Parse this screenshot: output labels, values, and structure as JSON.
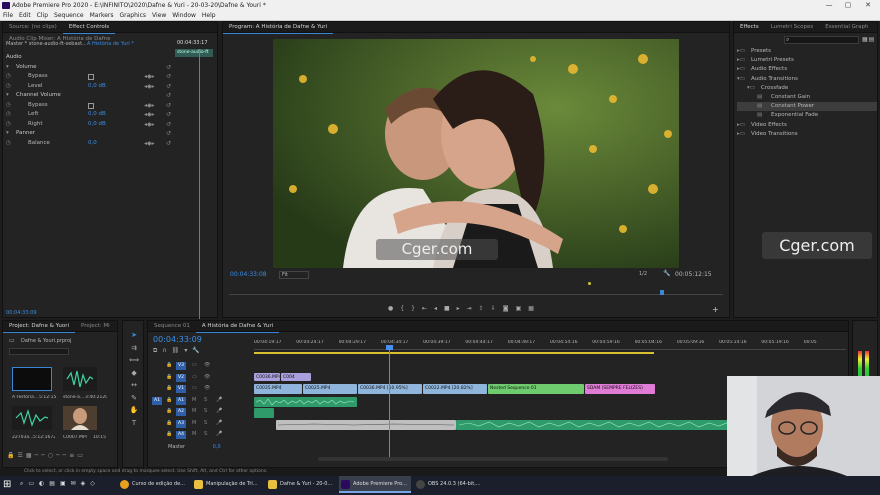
{
  "window": {
    "title": "Adobe Premiere Pro 2020 - E:\\INFINITO\\2020\\Dafne & Yuri - 20-03-20\\Dafne & Youri *",
    "controls": [
      "—",
      "▢",
      "✕"
    ]
  },
  "menu": [
    "File",
    "Edit",
    "Clip",
    "Sequence",
    "Markers",
    "Graphics",
    "View",
    "Window",
    "Help"
  ],
  "source_panel": {
    "tabs": [
      "Source: (no clips)",
      "Effect Controls",
      "Audio Clip Mixer: A História de Dafne"
    ],
    "active_tab": 1,
    "master_label": "Master * stone-audio-ft-sebast...",
    "sequence_label": "A História de Yuri *",
    "clip_tag": "stone-audio-ft",
    "header_time": "00:04:33:17",
    "section": "Audio",
    "params": [
      {
        "name": "Volume",
        "type": "group"
      },
      {
        "name": "Bypass",
        "type": "check"
      },
      {
        "name": "Level",
        "value": "0,0 dB"
      },
      {
        "name": "Channel Volume",
        "type": "group"
      },
      {
        "name": "Bypass",
        "type": "check"
      },
      {
        "name": "Left",
        "value": "0,0 dB"
      },
      {
        "name": "Right",
        "value": "0,0 dB"
      },
      {
        "name": "Panner",
        "type": "group"
      },
      {
        "name": "Balance",
        "value": "0,0"
      }
    ],
    "footer_time": "00:04:33:09"
  },
  "program_panel": {
    "tab": "Program: A História de Dafne & Yuri",
    "time": "00:04:33:08",
    "fit": "Fit",
    "zoom": "1/2",
    "duration": "00:05:12:15",
    "watermark": "Cger.com"
  },
  "effects_panel": {
    "tabs": [
      "Effects",
      "Lumetri Scopes",
      "Essential Graph"
    ],
    "tree": [
      {
        "label": "Presets",
        "level": 0,
        "open": false
      },
      {
        "label": "Lumetri Presets",
        "level": 0,
        "open": false
      },
      {
        "label": "Audio Effects",
        "level": 0,
        "open": false
      },
      {
        "label": "Audio Transitions",
        "level": 0,
        "open": true
      },
      {
        "label": "Crossfade",
        "level": 1,
        "open": true
      },
      {
        "label": "Constant Gain",
        "level": 2
      },
      {
        "label": "Constant Power",
        "level": 2,
        "selected": true
      },
      {
        "label": "Exponential Fade",
        "level": 2
      },
      {
        "label": "Video Effects",
        "level": 0,
        "open": false
      },
      {
        "label": "Video Transitions",
        "level": 0,
        "open": false
      }
    ],
    "watermark": "Cger.com"
  },
  "project_panel": {
    "tabs": [
      "Project: Dafne & Yuori",
      "Project: Mi"
    ],
    "filename": "Dafne & Youri.prproj",
    "items": [
      {
        "name": "A História...",
        "dur": "5:12:15"
      },
      {
        "name": "stone-a...",
        "dur": "3:40:21200"
      },
      {
        "name": "22703a...",
        "dur": "5:12:16720"
      },
      {
        "name": "C0007.MP4",
        "dur": "10:15"
      }
    ]
  },
  "timeline": {
    "tabs": [
      "Sequence 01",
      "A História de Dafne & Yuri"
    ],
    "active_tab": 1,
    "time": "00:04:33:09",
    "ruler": [
      "00:04:19:17",
      "00:04:24:17",
      "00:04:29:17",
      "00:04:34:17",
      "00:04:39:17",
      "00:04:44:17",
      "00:04:49:17",
      "00:04:54:16",
      "00:04:59:16",
      "00:05:04:16",
      "00:05:09:16",
      "00:05:14:16",
      "00:05:19:16",
      "00:05"
    ],
    "tracks": [
      "V3",
      "V2",
      "V1",
      "A1",
      "A2",
      "A3",
      "A4"
    ],
    "master_label": "Master",
    "master_value": "0,0",
    "clips_v2": [
      "C0036.MP4",
      "C004"
    ],
    "clips_v1": [
      "C0035.MP4",
      "C0025.MP4",
      "C0036.MP4 [50.95%]",
      "C0022.MP4 [20.82%]",
      "Nested Sequence 01",
      "SDAM (SEMPRE FELIZES)"
    ]
  },
  "status_bar": "Click to select, or click in empty space and drag to marquee select. Use Shift, Alt, and Ctrl for other options.",
  "taskbar": {
    "items": [
      "Curso de edição de...",
      "Manipulação de Tri...",
      "Dafne & Yuri - 20-0...",
      "Adobe Premiere Pro...",
      "OBS 24.0.3 (64-bit,..."
    ]
  },
  "colors": {
    "accent": "#3a8ee6",
    "playhead": "#4a8ef0",
    "clip_blue": "#8fb5dc",
    "clip_green": "#6ecc6e",
    "clip_pink": "#e07bd6",
    "audio": "#2f9a6a"
  }
}
